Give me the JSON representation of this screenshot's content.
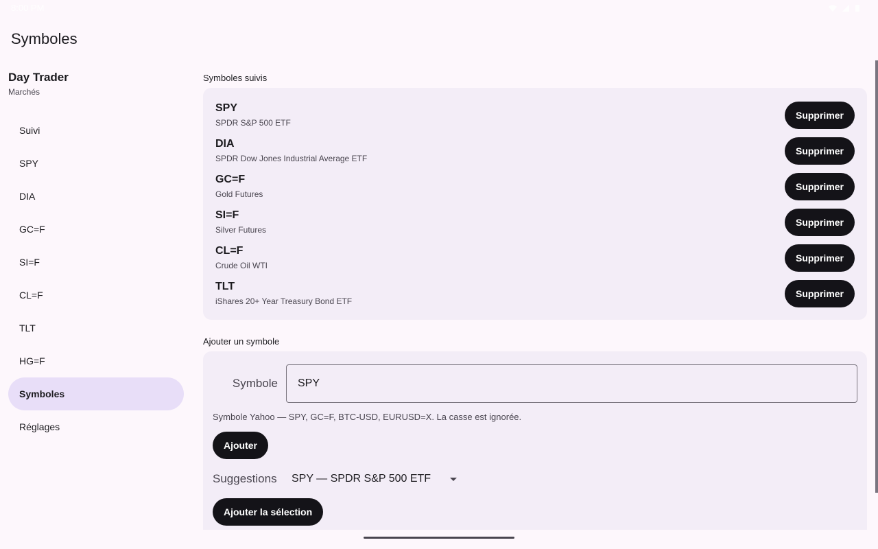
{
  "status": {
    "time": "8:00 PM"
  },
  "page": {
    "title": "Symboles"
  },
  "sidebar": {
    "app_name": "Day Trader",
    "app_sub": "Marchés",
    "items": [
      {
        "label": "Suivi"
      },
      {
        "label": "SPY"
      },
      {
        "label": "DIA"
      },
      {
        "label": "GC=F"
      },
      {
        "label": "SI=F"
      },
      {
        "label": "CL=F"
      },
      {
        "label": "TLT"
      },
      {
        "label": "HG=F"
      },
      {
        "label": "Symboles",
        "active": true
      },
      {
        "label": "Réglages"
      }
    ]
  },
  "watchlist": {
    "label": "Symboles suivis",
    "remove_label": "Supprimer",
    "rows": [
      {
        "symbol": "SPY",
        "name": "SPDR S&P 500 ETF"
      },
      {
        "symbol": "DIA",
        "name": "SPDR Dow Jones Industrial Average ETF"
      },
      {
        "symbol": "GC=F",
        "name": "Gold Futures"
      },
      {
        "symbol": "SI=F",
        "name": "Silver Futures"
      },
      {
        "symbol": "CL=F",
        "name": "Crude Oil WTI"
      },
      {
        "symbol": "TLT",
        "name": "iShares 20+ Year Treasury Bond ETF"
      }
    ]
  },
  "add": {
    "label": "Ajouter un symbole",
    "field_label": "Symbole",
    "field_value": "SPY",
    "hint": "Symbole Yahoo — SPY, GC=F, BTC-USD, EURUSD=X. La casse est ignorée.",
    "add_button": "Ajouter",
    "suggestions_label": "Suggestions",
    "suggestion_selected": "SPY — SPDR S&P 500 ETF",
    "add_selection_button": "Ajouter la sélection"
  },
  "colors": {
    "background": "#fdf7fc",
    "card": "#f3edf7",
    "active_nav": "#e8def8",
    "button": "#141318"
  }
}
